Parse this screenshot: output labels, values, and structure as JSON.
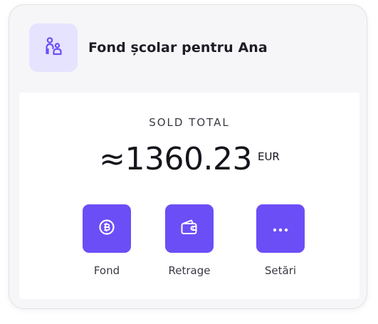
{
  "card": {
    "title": "Fond școlar pentru Ana",
    "avatar_icon": "family-icon"
  },
  "balance": {
    "label": "SOLD TOTAL",
    "amount": "≈1360.23",
    "currency": "EUR"
  },
  "actions": [
    {
      "label": "Fond",
      "icon": "coin-icon"
    },
    {
      "label": "Retrage",
      "icon": "wallet-icon"
    },
    {
      "label": "Setări",
      "icon": "more-icon"
    }
  ],
  "colors": {
    "accent": "#6c4ef7",
    "accent_light": "#e6e3ff",
    "card_bg": "#f6f6f8",
    "text_dark": "#15151c"
  }
}
